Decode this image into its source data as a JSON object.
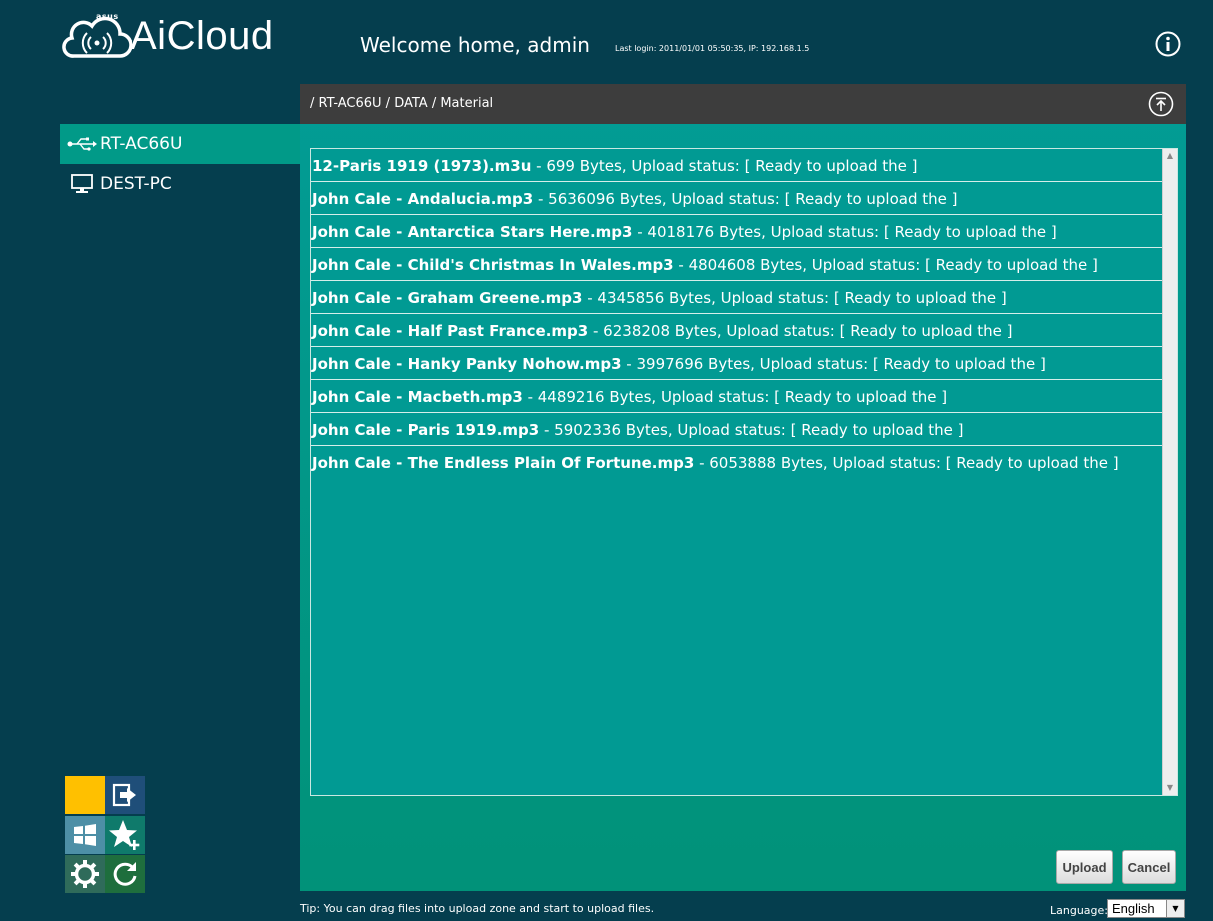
{
  "header": {
    "brand": "AiCloud",
    "brand_small": "asus",
    "welcome": "Welcome home, admin",
    "last_login": "Last login: 2011/01/01 05:50:35, IP: 192.168.1.5"
  },
  "sidebar": {
    "items": [
      {
        "label": "RT-AC66U",
        "icon": "usb-icon",
        "active": true
      },
      {
        "label": "DEST-PC",
        "icon": "computer-icon",
        "active": false
      }
    ]
  },
  "breadcrumb": "/ RT-AC66U / DATA / Material",
  "files": [
    {
      "name": "12-Paris 1919 (1973).m3u",
      "detail": " - 699 Bytes, Upload status: [ Ready to upload the ]"
    },
    {
      "name": "John Cale - Andalucia.mp3",
      "detail": " - 5636096 Bytes, Upload status: [ Ready to upload the ]"
    },
    {
      "name": "John Cale - Antarctica Stars Here.mp3",
      "detail": " - 4018176 Bytes, Upload status: [ Ready to upload the ]"
    },
    {
      "name": "John Cale - Child's Christmas In Wales.mp3",
      "detail": " - 4804608 Bytes, Upload status: [ Ready to upload the ]"
    },
    {
      "name": "John Cale - Graham Greene.mp3",
      "detail": " - 4345856 Bytes, Upload status: [ Ready to upload the ]"
    },
    {
      "name": "John Cale - Half Past France.mp3",
      "detail": " - 6238208 Bytes, Upload status: [ Ready to upload the ]"
    },
    {
      "name": "John Cale - Hanky Panky Nohow.mp3",
      "detail": " - 3997696 Bytes, Upload status: [ Ready to upload the ]"
    },
    {
      "name": "John Cale - Macbeth.mp3",
      "detail": " - 4489216 Bytes, Upload status: [ Ready to upload the ]"
    },
    {
      "name": "John Cale - Paris 1919.mp3",
      "detail": " - 5902336 Bytes, Upload status: [ Ready to upload the ]"
    },
    {
      "name": "John Cale - The Endless Plain Of Fortune.mp3",
      "detail": " - 6053888 Bytes, Upload status: [ Ready to upload the ]"
    }
  ],
  "buttons": {
    "upload": "Upload",
    "cancel": "Cancel"
  },
  "tiles": [
    {
      "icon": "blank-tile",
      "color": "#ffc000"
    },
    {
      "icon": "logout-icon",
      "color": "#1f4e79"
    },
    {
      "icon": "windows-icon",
      "color": "#4d8fa6"
    },
    {
      "icon": "favorite-add-icon",
      "color": "#0f7a6b"
    },
    {
      "icon": "settings-icon",
      "color": "#2f6b5a"
    },
    {
      "icon": "refresh-icon",
      "color": "#1e6e3d"
    }
  ],
  "footer": {
    "tip": "Tip: You can drag files into upload zone and start to upload files.",
    "language_label": "Language:",
    "language_value": "English"
  },
  "colors": {
    "background": "#053e4e",
    "accent": "#019a88",
    "breadcrumb_bar": "#3d3d3d"
  }
}
